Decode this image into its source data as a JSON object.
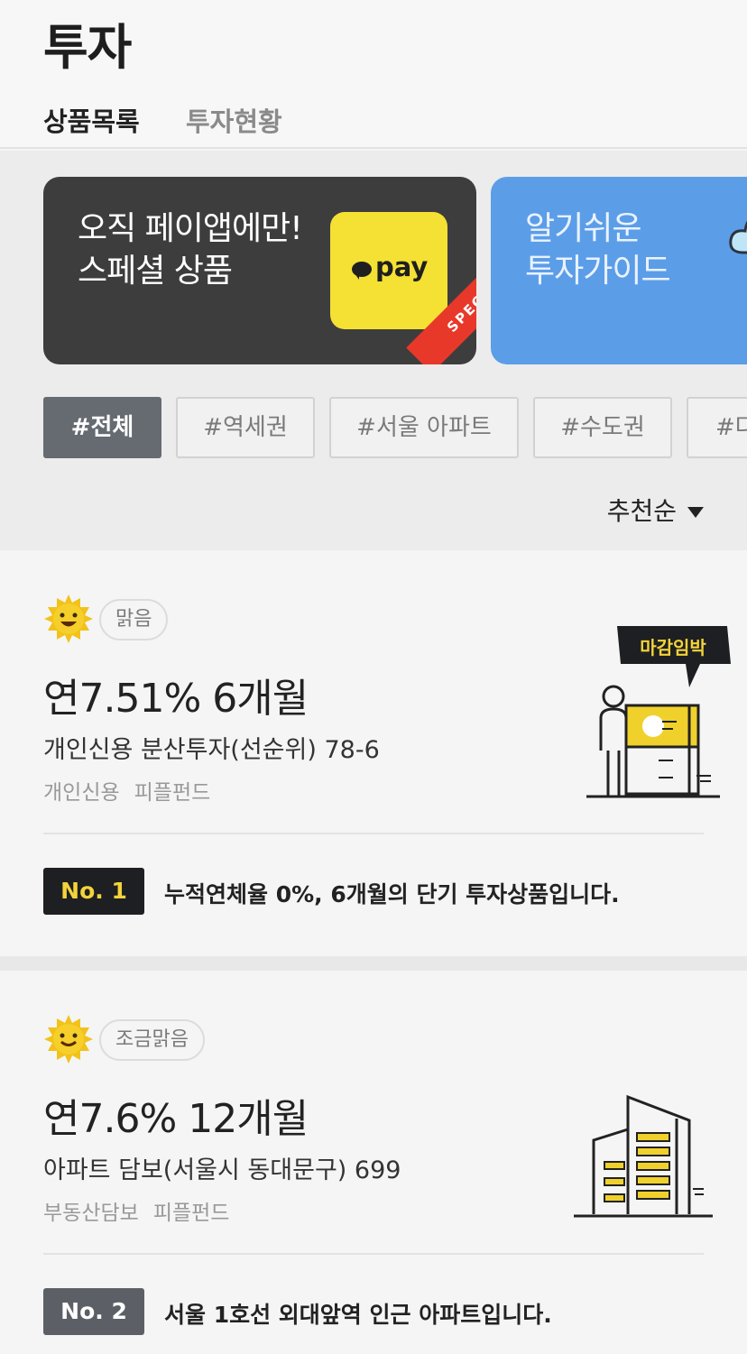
{
  "header": {
    "title": "투자"
  },
  "tabs": [
    {
      "label": "상품목록",
      "active": true
    },
    {
      "label": "투자현황",
      "active": false
    }
  ],
  "banners": [
    {
      "line1": "오직 페이앱에만!",
      "line2": "스페셜 상품",
      "badge": "pay",
      "ribbon": "SPECIAL"
    },
    {
      "line1": "알기쉬운",
      "line2": "투자가이드"
    }
  ],
  "tags": [
    "#전체",
    "#역세권",
    "#서울 아파트",
    "#수도권",
    "#다"
  ],
  "sort": {
    "label": "추천순"
  },
  "products": [
    {
      "weather": "맑음",
      "rate": "연7.51%  6개월",
      "name": "개인신용 분산투자(선순위) 78-6",
      "category": "개인신용",
      "provider": "피플펀드",
      "rank": "No. 1",
      "description": "누적연체율 0%, 6개월의 단기 투자상품입니다.",
      "sticker": "마감임박"
    },
    {
      "weather": "조금맑음",
      "rate": "연7.6%  12개월",
      "name": "아파트 담보(서울시 동대문구) 699",
      "category": "부동산담보",
      "provider": "피플펀드",
      "rank": "No. 2",
      "description": "서울 1호선 외대앞역 인근 아파트입니다."
    }
  ],
  "colors": {
    "accent_yellow": "#f5e034",
    "banner_dark": "#3d3d3d",
    "banner_blue": "#5c9de8",
    "ribbon_red": "#e8382a",
    "tag_active": "#666b72"
  },
  "icons": [
    "pay-icon",
    "cloud-icon",
    "sun-icon",
    "person-board-icon",
    "building-icon",
    "caret-down-icon"
  ]
}
